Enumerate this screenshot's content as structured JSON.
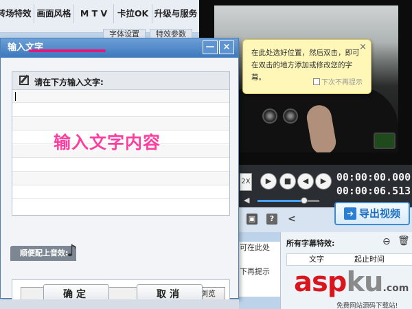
{
  "top_menu": {
    "items": [
      {
        "label": "转场特效"
      },
      {
        "label": "画面风格"
      },
      {
        "label": "M T V"
      },
      {
        "label": "卡拉OK"
      },
      {
        "label": "升级与服务"
      }
    ],
    "subtabs": [
      {
        "label": "字体设置"
      },
      {
        "label": "特效参数"
      }
    ]
  },
  "tooltip": {
    "text": "在此处选好位置，然后双击，即可在双击的地方添加或修改您的字幕。",
    "checkbox_label": "下次不再提示",
    "close": "×"
  },
  "player": {
    "speed": "2X",
    "current_time": "00:00:00.000",
    "total_time": "00:00:06.513",
    "volume_fraction": 0.75
  },
  "export": {
    "label": "导出视频"
  },
  "subtitles_panel": {
    "title": "所有字幕特效:",
    "columns": [
      "文字",
      "起止时间"
    ],
    "partial_text": [
      "可在此处",
      "",
      "下再提示"
    ]
  },
  "dialog": {
    "title": "输入文字",
    "close": "×",
    "minimize": "—",
    "input_prompt": "请在下方输入文字:",
    "overlay": "输入文字内容",
    "music_label": "顺便配上音效:",
    "music_note": "♪",
    "music_file_value": "",
    "browse": "浏览",
    "ok": "确定",
    "cancel": "取消"
  },
  "watermark": {
    "asp": "asp",
    "ku": "ku",
    "com": ".com",
    "sub": "免费网站源码下载站!"
  },
  "colors": {
    "accent": "#3d78bd",
    "highlight": "#e6187a",
    "overlay_text": "#ff3fa0",
    "watermark_red": "#d8161c"
  }
}
